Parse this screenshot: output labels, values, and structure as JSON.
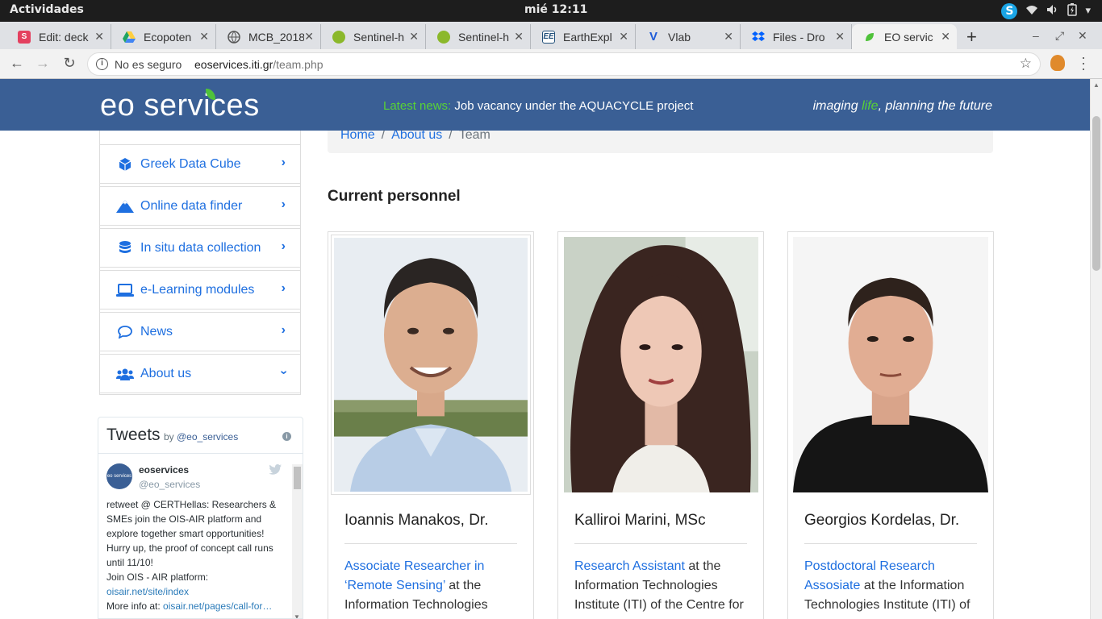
{
  "os": {
    "activities": "Actividades",
    "clock": "mié 12:11"
  },
  "browser": {
    "tabs": [
      {
        "title": "Edit: deck",
        "favicon": "slides-icon",
        "color": "#e4405f"
      },
      {
        "title": "Ecopoten",
        "favicon": "google-drive-icon",
        "color": "#1fa463"
      },
      {
        "title": "MCB_2018",
        "favicon": "globe-icon",
        "color": "#555555"
      },
      {
        "title": "Sentinel-h",
        "favicon": "sentinel-icon",
        "color": "#8bb82b"
      },
      {
        "title": "Sentinel-h",
        "favicon": "sentinel-icon",
        "color": "#8bb82b"
      },
      {
        "title": "EarthExpl",
        "favicon": "earthexplorer-icon",
        "color": "#1f4e79"
      },
      {
        "title": "Vlab",
        "favicon": "vlab-icon",
        "color": "#1e5bd8"
      },
      {
        "title": "Files - Dro",
        "favicon": "dropbox-icon",
        "color": "#0061fe"
      },
      {
        "title": "EO servic",
        "favicon": "leaf-icon",
        "color": "#4fc23a"
      }
    ],
    "security": "No es seguro",
    "url_host": "eoservices.iti.gr",
    "url_path": "/team.php"
  },
  "site": {
    "logo": "eo services",
    "news_label": "Latest news:",
    "news_text": " Job vacancy under the AQUACYCLE project",
    "tagline_a": "imaging ",
    "tagline_b": "life",
    "tagline_c": ", planning the future",
    "colors": {
      "header": "#3a5f95",
      "accent": "#58d236",
      "link": "#1e6fe0"
    }
  },
  "sidebar": {
    "items": [
      {
        "label": "Greek Data Cube",
        "icon": "cube-icon",
        "expanded": false
      },
      {
        "label": "Online data finder",
        "icon": "mountain-icon",
        "expanded": false
      },
      {
        "label": "In situ data collection",
        "icon": "database-icon",
        "expanded": false
      },
      {
        "label": "e-Learning modules",
        "icon": "laptop-icon",
        "expanded": false
      },
      {
        "label": "News",
        "icon": "comment-icon",
        "expanded": false
      },
      {
        "label": "About us",
        "icon": "users-icon",
        "expanded": true
      }
    ]
  },
  "twitter": {
    "title": "Tweets",
    "by": "by ",
    "handle": "@eo_services",
    "avatar_text": "eo services",
    "tweet_name": "eoservices",
    "tweet_handle": "@eo_services",
    "tweet_body": "retweet @ CERTHellas: Researchers & SMEs join the OIS-AIR platform and explore together smart opportunities! Hurry up, the proof of concept call runs until 11/10!",
    "join_text": "Join OIS - AIR platform:",
    "join_link": "oisair.net/site/index",
    "more_text": "More info at: ",
    "more_link": "oisair.net/pages/call-for…"
  },
  "breadcrumb": {
    "home": "Home",
    "about": "About us",
    "current": "Team",
    "sep": "/"
  },
  "main": {
    "section_title": "Current personnel",
    "people": [
      {
        "name": "Ioannis Manakos, Dr.",
        "role_link": "Associate Researcher in ‘Remote Sensing’",
        "role_rest": " at the Information Technologies"
      },
      {
        "name": "Kalliroi Marini, MSc",
        "role_link": "Research Assistant",
        "role_rest": " at the Information Technologies Institute (ITI) of the Centre for"
      },
      {
        "name": "Georgios Kordelas, Dr.",
        "role_link": "Postdoctoral Research Assosiate",
        "role_rest": " at the Information Technologies Institute (ITI) of"
      }
    ]
  }
}
